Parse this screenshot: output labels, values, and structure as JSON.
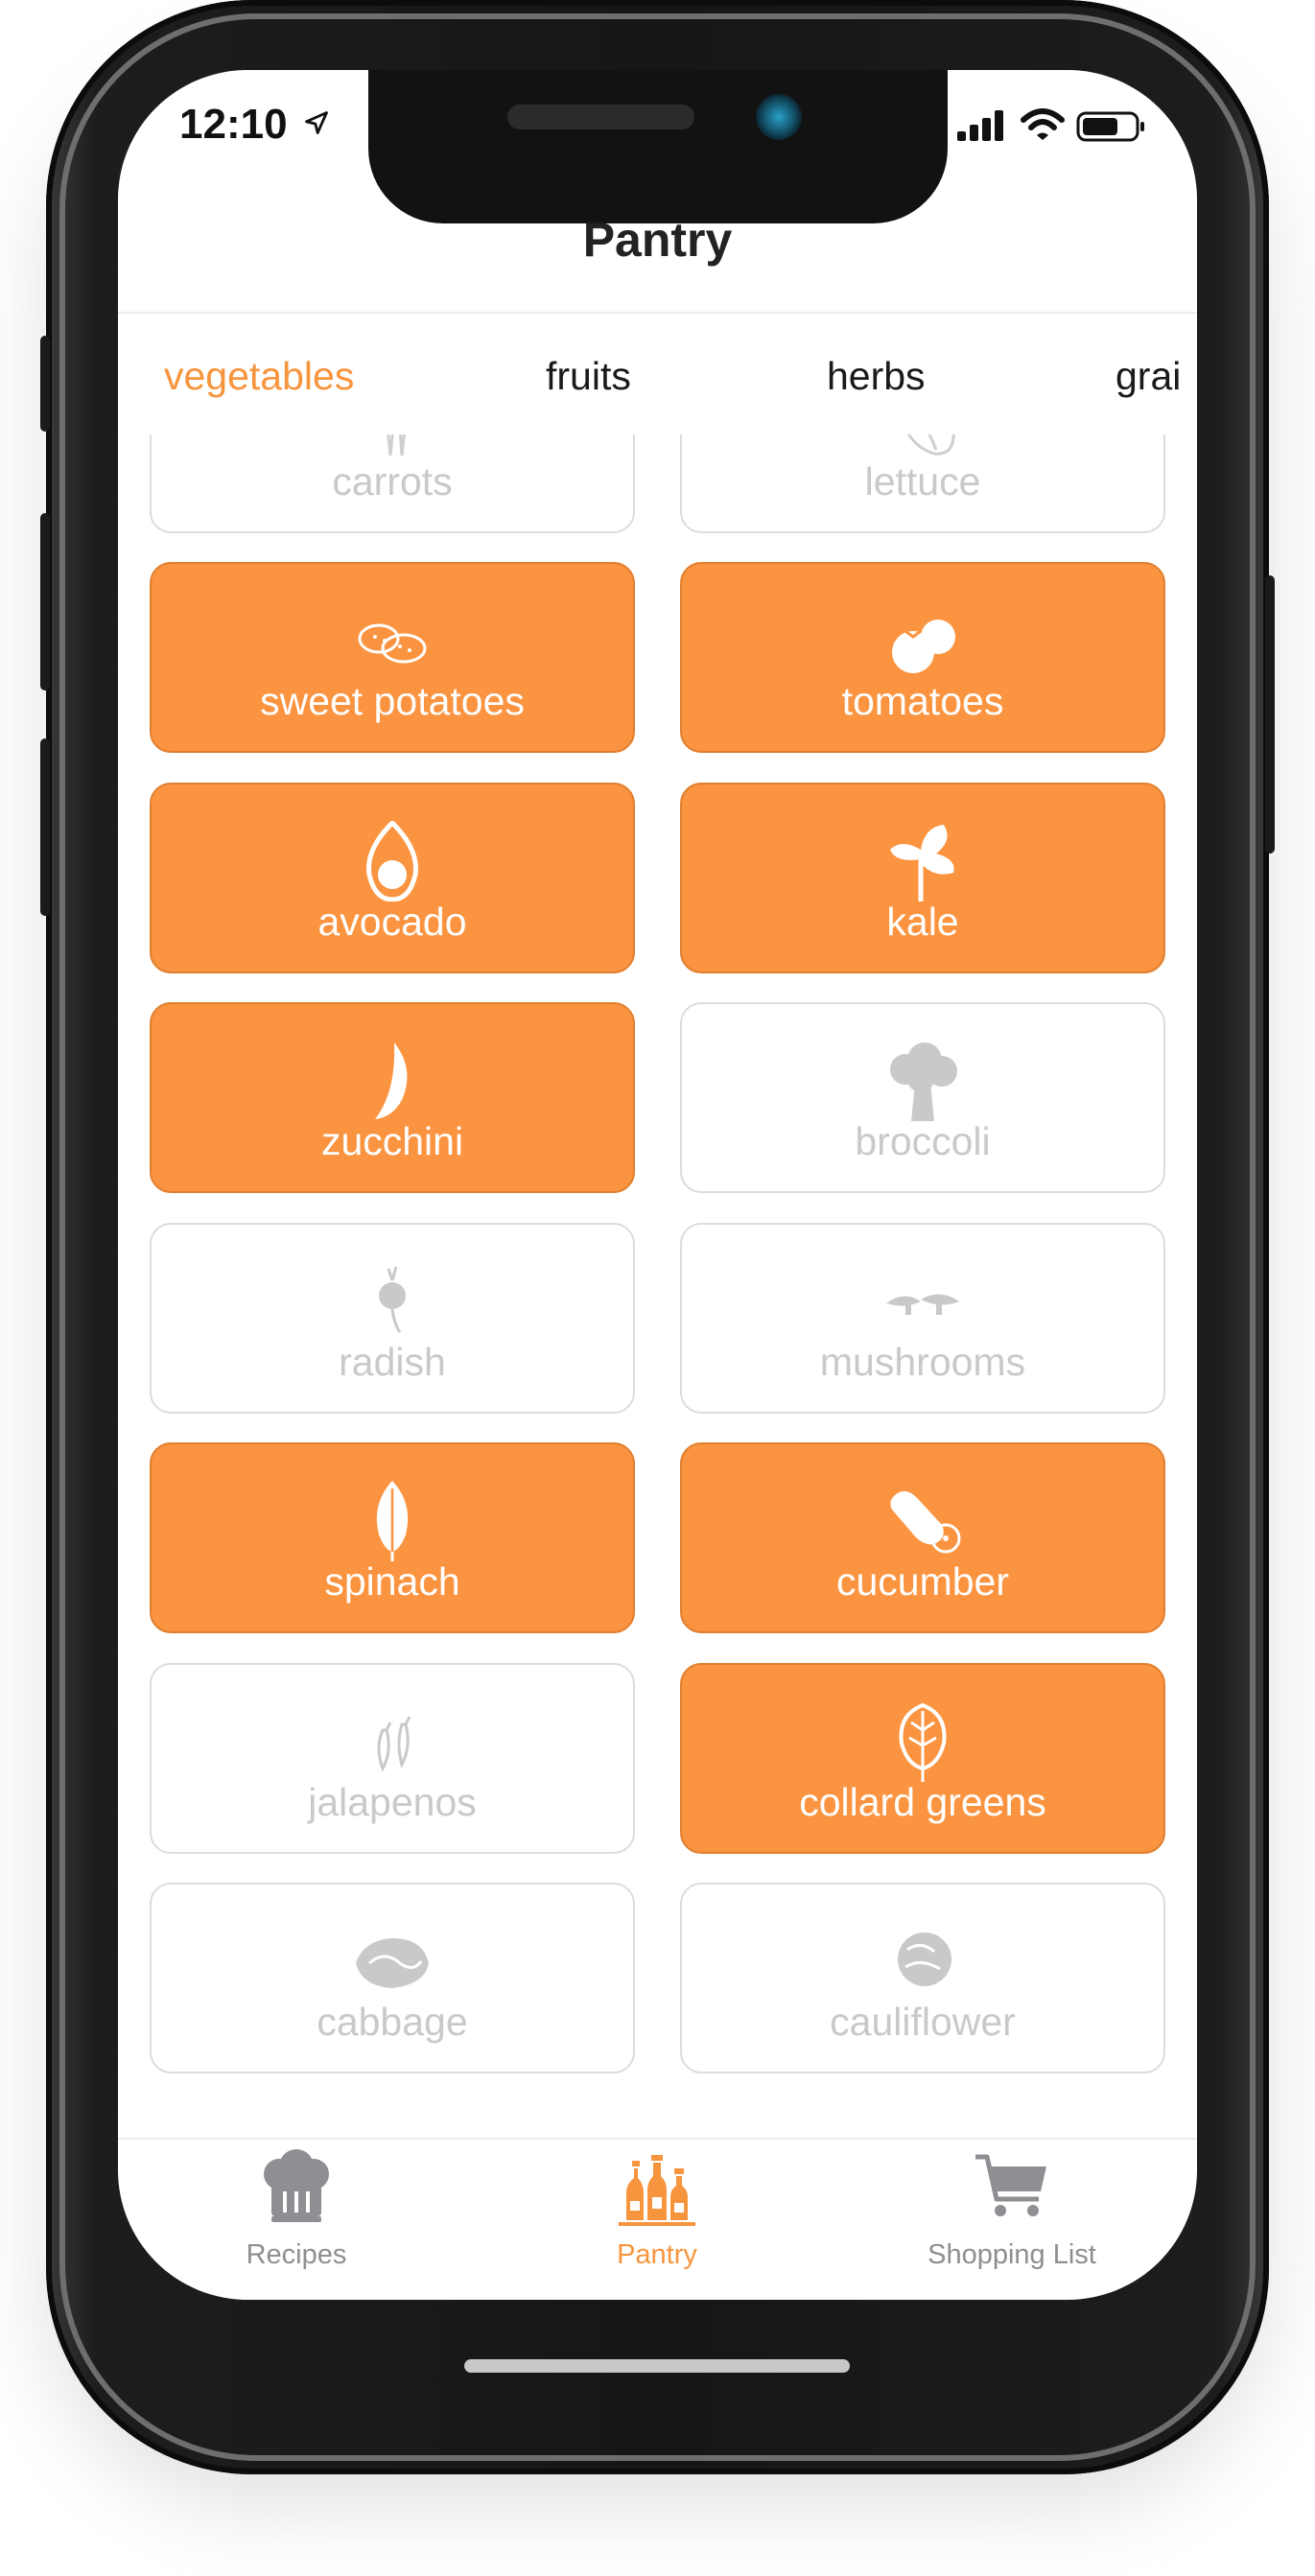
{
  "status_bar": {
    "time": "12:10"
  },
  "nav": {
    "title": "Pantry"
  },
  "category_tabs": [
    {
      "label": "vegetables",
      "active": true
    },
    {
      "label": "fruits",
      "active": false
    },
    {
      "label": "herbs",
      "active": false
    },
    {
      "label": "grai",
      "active": false
    }
  ],
  "items": [
    {
      "label": "carrots",
      "selected": false,
      "icon": "carrot-icon"
    },
    {
      "label": "lettuce",
      "selected": false,
      "icon": "lettuce-icon"
    },
    {
      "label": "sweet potatoes",
      "selected": true,
      "icon": "sweet-potato-icon"
    },
    {
      "label": "tomatoes",
      "selected": true,
      "icon": "tomato-icon"
    },
    {
      "label": "avocado",
      "selected": true,
      "icon": "avocado-icon"
    },
    {
      "label": "kale",
      "selected": true,
      "icon": "kale-icon"
    },
    {
      "label": "zucchini",
      "selected": true,
      "icon": "zucchini-icon"
    },
    {
      "label": "broccoli",
      "selected": false,
      "icon": "broccoli-icon"
    },
    {
      "label": "radish",
      "selected": false,
      "icon": "radish-icon"
    },
    {
      "label": "mushrooms",
      "selected": false,
      "icon": "mushroom-icon"
    },
    {
      "label": "spinach",
      "selected": true,
      "icon": "spinach-icon"
    },
    {
      "label": "cucumber",
      "selected": true,
      "icon": "cucumber-icon"
    },
    {
      "label": "jalapenos",
      "selected": false,
      "icon": "jalapeno-icon"
    },
    {
      "label": "collard greens",
      "selected": true,
      "icon": "collard-greens-icon"
    },
    {
      "label": "cabbage",
      "selected": false,
      "icon": "cabbage-icon"
    },
    {
      "label": "cauliflower",
      "selected": false,
      "icon": "cauliflower-icon"
    }
  ],
  "tab_bar": [
    {
      "label": "Recipes",
      "icon": "chef-hat-icon",
      "active": false
    },
    {
      "label": "Pantry",
      "icon": "pantry-bottles-icon",
      "active": true
    },
    {
      "label": "Shopping List",
      "icon": "shopping-cart-icon",
      "active": false
    }
  ],
  "colors": {
    "accent": "#f7953e",
    "card_selected": "#fb9440",
    "card_unselected_border": "#dcdcdc",
    "unselected_text": "#c9c9c9",
    "tab_inactive": "#8e8e93"
  }
}
